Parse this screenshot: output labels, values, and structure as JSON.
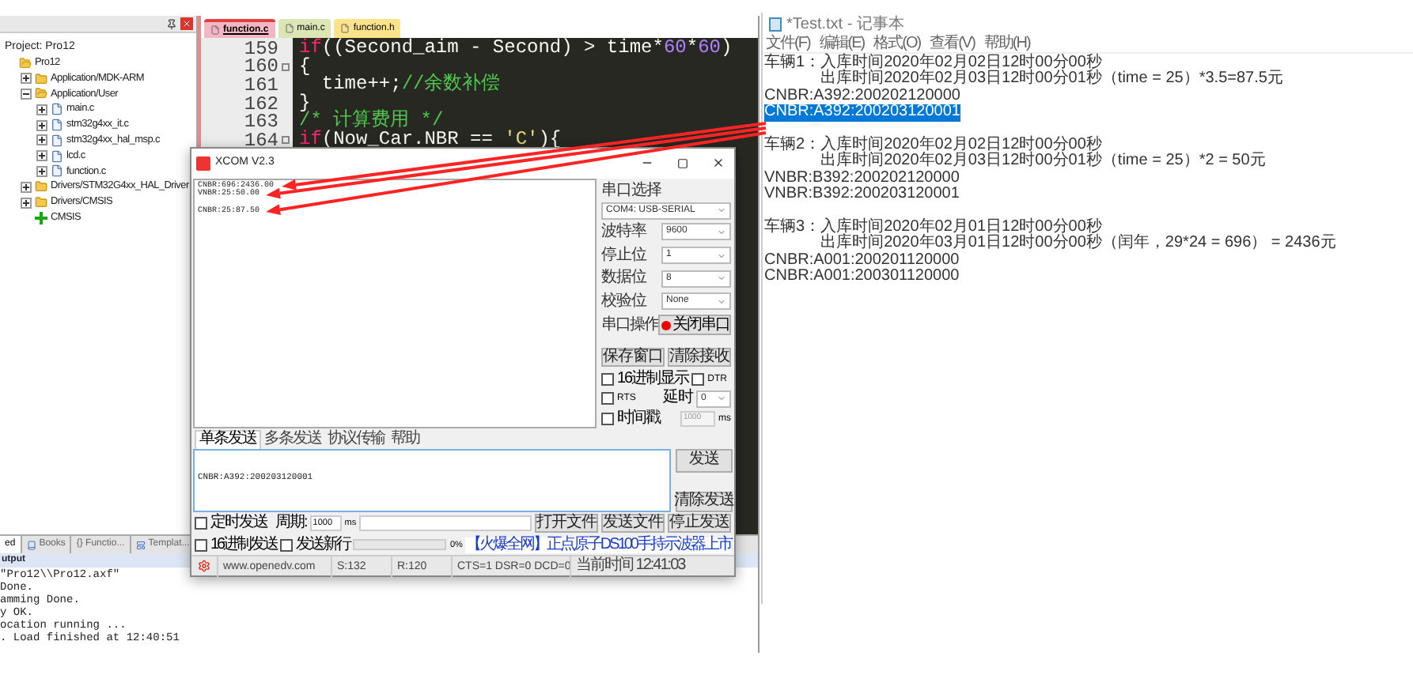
{
  "ide": {
    "project_panel": {
      "heading": "Project: Pro12",
      "tree": [
        {
          "label": "Pro12",
          "kind": "root",
          "children": [
            {
              "label": "Application/MDK-ARM",
              "kind": "folder",
              "expanded": false
            },
            {
              "label": "Application/User",
              "kind": "folder",
              "expanded": true,
              "children": [
                {
                  "label": "main.c",
                  "kind": "file",
                  "expanded": false
                },
                {
                  "label": "stm32g4xx_it.c",
                  "kind": "file",
                  "expanded": false
                },
                {
                  "label": "stm32g4xx_hal_msp.c",
                  "kind": "file",
                  "expanded": false
                },
                {
                  "label": "lcd.c",
                  "kind": "file",
                  "expanded": false
                },
                {
                  "label": "function.c",
                  "kind": "file",
                  "expanded": false
                }
              ]
            },
            {
              "label": "Drivers/STM32G4xx_HAL_Driver",
              "kind": "folder",
              "expanded": false
            },
            {
              "label": "Drivers/CMSIS",
              "kind": "folder",
              "expanded": false
            },
            {
              "label": "CMSIS",
              "kind": "component"
            }
          ]
        }
      ]
    },
    "editor_tabs": [
      {
        "label": "function.c",
        "selected": true,
        "color": "#f4b6c2"
      },
      {
        "label": "main.c",
        "selected": false,
        "color": "#dbe6b4"
      },
      {
        "label": "function.h",
        "selected": false,
        "color": "#fbe38a"
      }
    ],
    "code_lines": [
      {
        "number": "159",
        "fold": false,
        "tokens": [
          {
            "text": "if",
            "kind": "keyword"
          },
          {
            "text": "((Second_aim - Second) > time*",
            "kind": "plain"
          },
          {
            "text": "60",
            "kind": "number"
          },
          {
            "text": "*",
            "kind": "plain"
          },
          {
            "text": "60",
            "kind": "number"
          },
          {
            "text": ")",
            "kind": "plain"
          }
        ]
      },
      {
        "number": "160",
        "fold": true,
        "tokens": [
          {
            "text": "{",
            "kind": "plain"
          }
        ]
      },
      {
        "number": "161",
        "fold": false,
        "tokens": [
          {
            "text": "  time++;",
            "kind": "plain"
          },
          {
            "text": "//余数补偿",
            "kind": "comment"
          }
        ]
      },
      {
        "number": "162",
        "fold": false,
        "tokens": [
          {
            "text": "}",
            "kind": "plain"
          }
        ]
      },
      {
        "number": "163",
        "fold": false,
        "tokens": [
          {
            "text": "/* 计算费用 */",
            "kind": "comment"
          }
        ]
      },
      {
        "number": "164",
        "fold": true,
        "tokens": [
          {
            "text": "if",
            "kind": "keyword"
          },
          {
            "text": "(Now_Car.NBR == ",
            "kind": "plain"
          },
          {
            "text": "'C'",
            "kind": "string"
          },
          {
            "text": "){",
            "kind": "plain"
          }
        ]
      }
    ],
    "bottom_tabs": [
      {
        "label": "ed",
        "kind": "text",
        "selected": true
      },
      {
        "label": "Books",
        "kind": "books",
        "selected": false
      },
      {
        "label": "{} Functio...",
        "kind": "text",
        "selected": false
      },
      {
        "label": "Templat...",
        "kind": "templates",
        "selected": false
      }
    ],
    "output": {
      "title": "utput",
      "lines": [
        "\"Pro12\\\\Pro12.axf\"",
        "Done.",
        "amming Done.",
        "y OK.",
        "ocation running ...",
        ". Load finished at 12:40:51"
      ]
    }
  },
  "xcom": {
    "title": "XCOM V2.3",
    "receive_lines": [
      {
        "text": "CNBR:696:2436.00",
        "blank_before": false
      },
      {
        "text": "VNBR:25:50.00",
        "blank_before": false
      },
      {
        "text": "CNBR:25:87.50",
        "blank_before": true
      }
    ],
    "port_label": "串口选择",
    "port": "COM4: USB-SERIAL",
    "fields": [
      {
        "label": "波特率",
        "value": "9600"
      },
      {
        "label": "停止位",
        "value": "1"
      },
      {
        "label": "数据位",
        "value": "8"
      },
      {
        "label": "校验位",
        "value": "None"
      }
    ],
    "port_action": {
      "label": "串口操作",
      "button": "关闭串口",
      "open": true
    },
    "buttons": [
      "保存窗口",
      "清除接收"
    ],
    "hex_display": {
      "label": "16进制显示",
      "checked": false
    },
    "dtr": {
      "label": "DTR",
      "checked": false
    },
    "rts": {
      "label": "RTS",
      "checked": false
    },
    "delay": {
      "label": "延时",
      "value": "0"
    },
    "timestamp": {
      "label": "时间戳",
      "checked": false,
      "value": "1000",
      "disabled": true,
      "unit": "ms"
    },
    "send_tabs": [
      {
        "label": "单条发送",
        "selected": true
      },
      {
        "label": "多条发送",
        "selected": false
      },
      {
        "label": "协议传输",
        "selected": false
      },
      {
        "label": "帮助",
        "selected": false
      }
    ],
    "send_text": "CNBR:A392:200203120001",
    "send_button": "发送",
    "clear_button": "清除发送",
    "timer": {
      "label": "定时发送",
      "checked": false,
      "period_label": "周期:",
      "period": "1000",
      "unit": "ms"
    },
    "file_buttons": [
      "打开文件",
      "发送文件",
      "停止发送"
    ],
    "hex_send": {
      "label": "16进制发送",
      "checked": false
    },
    "new_line": {
      "label": "发送新行",
      "checked": false
    },
    "progress": {
      "level": 0,
      "reading": "0%"
    },
    "ad_link": "【火爆全网】正点原子DS100手持示波器上市",
    "status": [
      "www.openedv.com",
      "S:132",
      "R:120",
      "CTS=1 DSR=0 DCD=0",
      "当前时间 12:41:03"
    ]
  },
  "notepad": {
    "title": "*Test.txt - 记事本",
    "menu": [
      "文件(F)",
      "编辑(E)",
      "格式(O)",
      "查看(V)",
      "帮助(H)"
    ],
    "vehicles": [
      {
        "label": "车辆1：",
        "lines": [
          "入库时间2020年02月02日12时00分00秒",
          "出库时间2020年02月03日12时00分01秒（time = 25）*3.5=87.5元"
        ],
        "codes": [
          {
            "text": "CNBR:A392:200202120000",
            "selected": false
          },
          {
            "text": "CNBR:A392:200203120001",
            "selected": true
          }
        ]
      },
      {
        "label": "车辆2：",
        "lines": [
          "入库时间2020年02月02日12时00分00秒",
          "出库时间2020年02月03日12时00分01秒（time = 25）*2 = 50元"
        ],
        "codes": [
          {
            "text": "VNBR:B392:200202120000",
            "selected": false
          },
          {
            "text": "VNBR:B392:200203120001",
            "selected": false
          }
        ]
      },
      {
        "label": "车辆3：",
        "lines": [
          "入库时间2020年02月01日12时00分00秒",
          "出库时间2020年03月01日12时00分00秒（闰年，29*24 = 696） = 2436元"
        ],
        "codes": [
          {
            "text": "CNBR:A001:200201120000",
            "selected": false
          },
          {
            "text": "CNBR:A001:200301120000",
            "selected": false
          }
        ]
      }
    ]
  }
}
